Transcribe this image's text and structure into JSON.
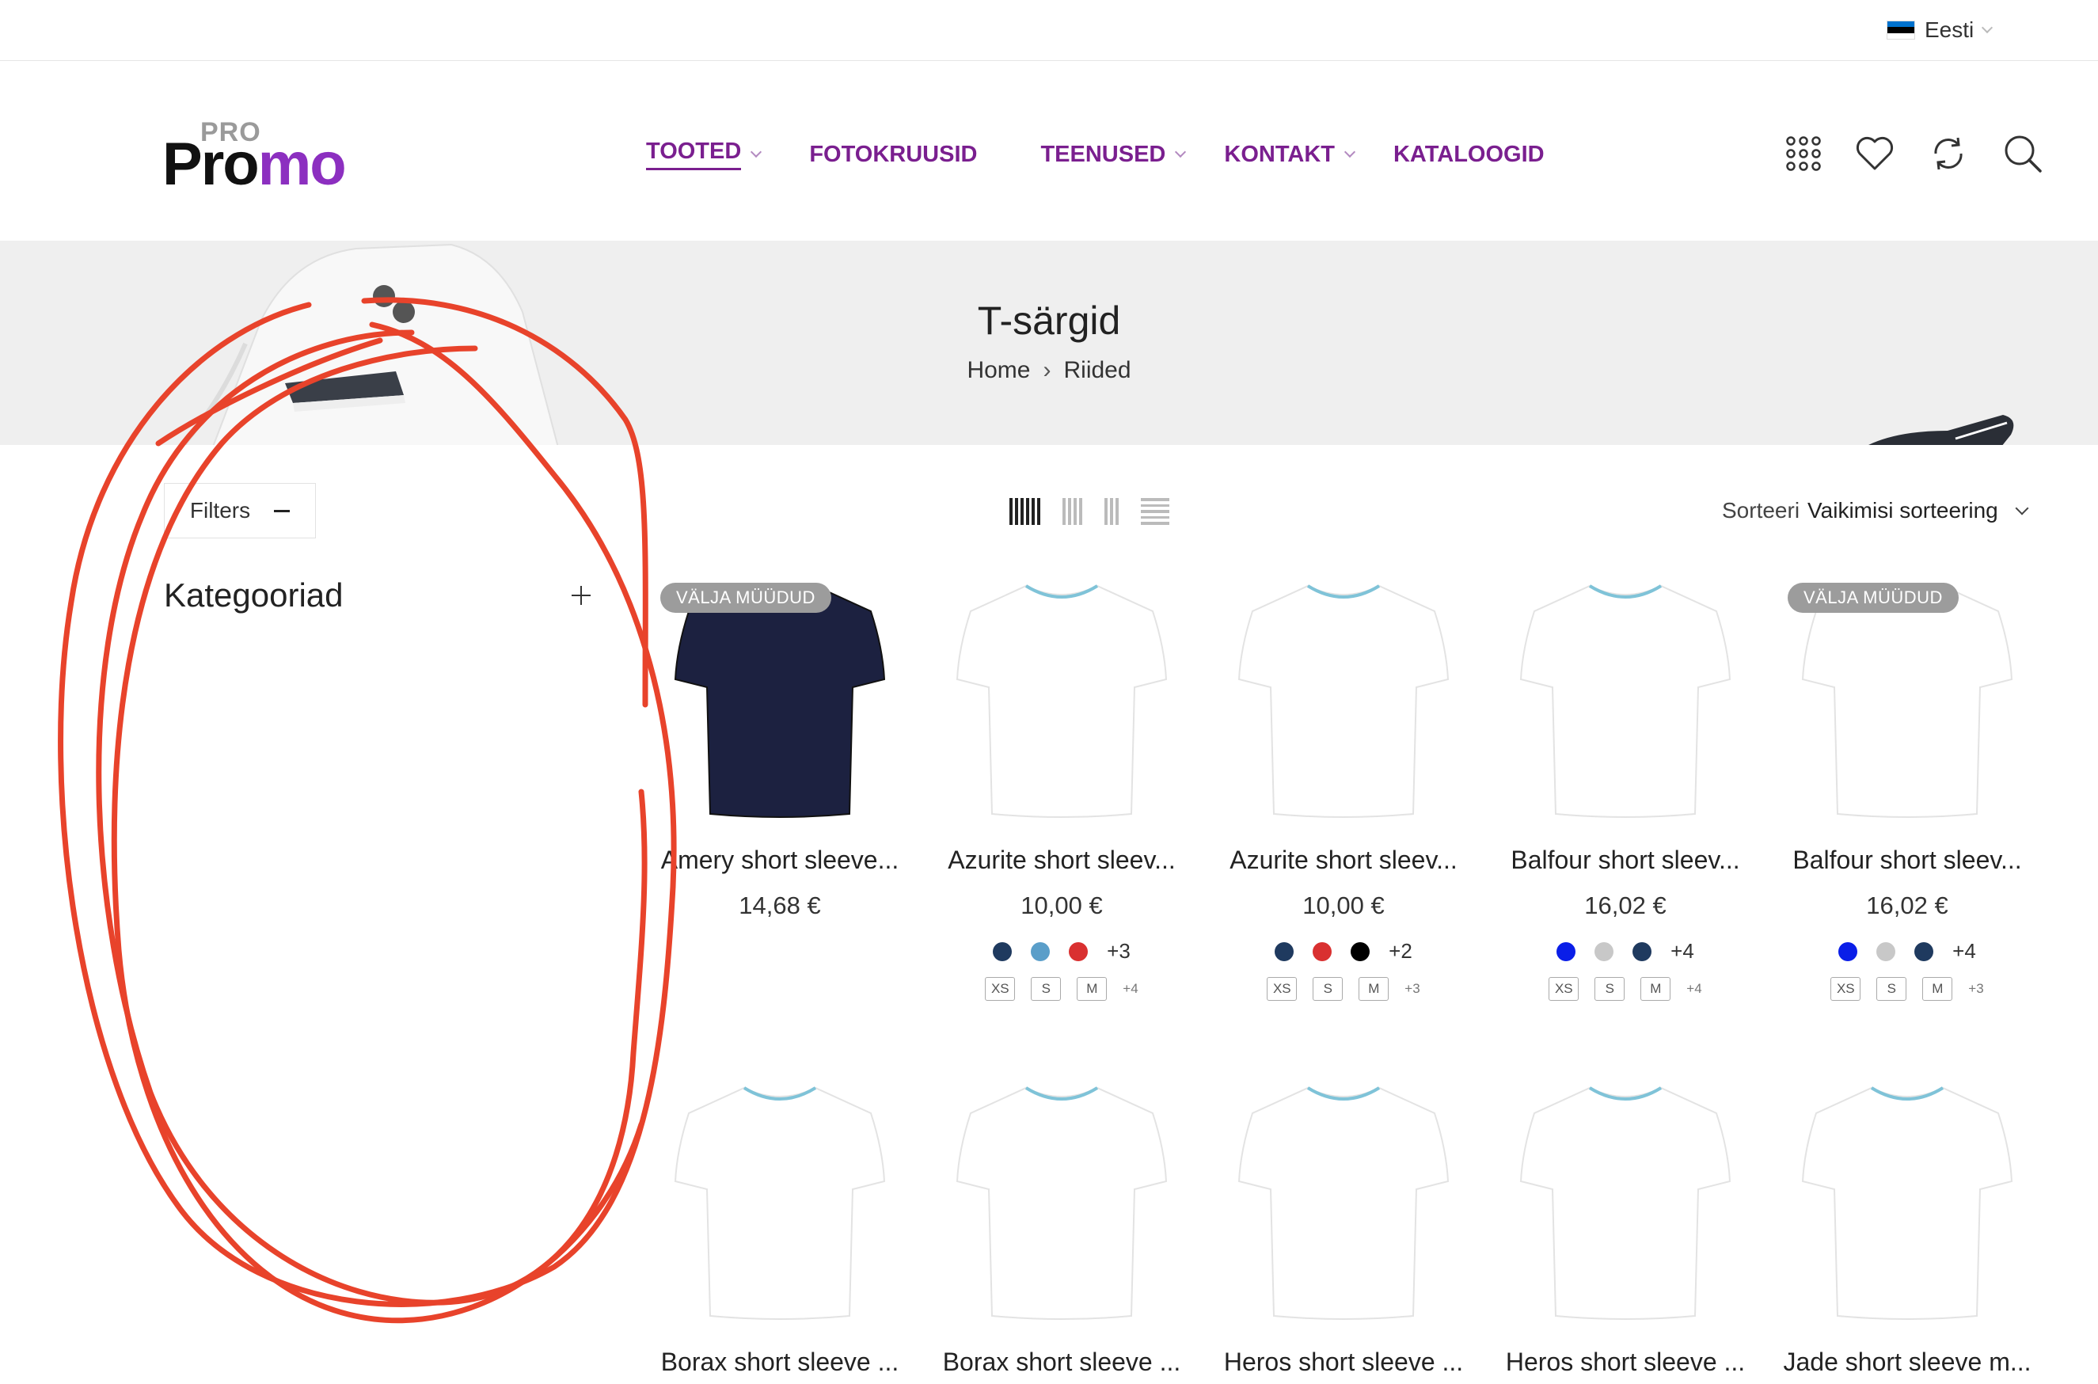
{
  "topbar": {
    "language": "Eesti"
  },
  "logo": {
    "small": "PRO",
    "part1": "Pro",
    "part2": "mo"
  },
  "nav": [
    {
      "label": "TOOTED",
      "dropdown": true,
      "active": true
    },
    {
      "label": "FOTOKRUUSID",
      "dropdown": false,
      "active": false
    },
    {
      "label": "TEENUSED",
      "dropdown": true,
      "active": false
    },
    {
      "label": "KONTAKT",
      "dropdown": true,
      "active": false
    },
    {
      "label": "KATALOOGID",
      "dropdown": false,
      "active": false
    }
  ],
  "banner": {
    "title": "T-särgid",
    "breadcrumb": [
      "Home",
      "Riided"
    ]
  },
  "sidebar": {
    "filters_label": "Filters",
    "category_title": "Kategooriad"
  },
  "sort": {
    "label": "Sorteeri",
    "value": "Vaikimisi sorteering"
  },
  "products": [
    {
      "name": "Amery short sleeve...",
      "price": "14,68 €",
      "badge": "VÄLJA MÜÜDUD",
      "shirt": "#1c2140",
      "colors": [],
      "colors_more": "",
      "sizes": [],
      "sizes_more": ""
    },
    {
      "name": "Azurite short sleev...",
      "price": "10,00 €",
      "badge": "",
      "shirt": "#ffffff",
      "colors": [
        "#1f3a5f",
        "#5a9ec9",
        "#d93030"
      ],
      "colors_more": "+3",
      "sizes": [
        "XS",
        "S",
        "M"
      ],
      "sizes_more": "+4"
    },
    {
      "name": "Azurite short sleev...",
      "price": "10,00 €",
      "badge": "",
      "shirt": "#ffffff",
      "colors": [
        "#1f3a5f",
        "#d93030",
        "#000000"
      ],
      "colors_more": "+2",
      "sizes": [
        "XS",
        "S",
        "M"
      ],
      "sizes_more": "+3"
    },
    {
      "name": "Balfour short sleev...",
      "price": "16,02 €",
      "badge": "",
      "shirt": "#ffffff",
      "colors": [
        "#0a1ee8",
        "#c8c8c8",
        "#1f3a5f"
      ],
      "colors_more": "+4",
      "sizes": [
        "XS",
        "S",
        "M"
      ],
      "sizes_more": "+4"
    },
    {
      "name": "Balfour short sleev...",
      "price": "16,02 €",
      "badge": "VÄLJA MÜÜDUD",
      "shirt": "#ffffff",
      "colors": [
        "#0a1ee8",
        "#c8c8c8",
        "#1f3a5f"
      ],
      "colors_more": "+4",
      "sizes": [
        "XS",
        "S",
        "M"
      ],
      "sizes_more": "+3"
    },
    {
      "name": "Borax short sleeve ...",
      "price": "",
      "badge": "",
      "shirt": "#ffffff",
      "colors": [],
      "colors_more": "",
      "sizes": [],
      "sizes_more": ""
    },
    {
      "name": "Borax short sleeve ...",
      "price": "",
      "badge": "",
      "shirt": "#ffffff",
      "colors": [],
      "colors_more": "",
      "sizes": [],
      "sizes_more": ""
    },
    {
      "name": "Heros short sleeve ...",
      "price": "",
      "badge": "",
      "shirt": "#ffffff",
      "colors": [],
      "colors_more": "",
      "sizes": [],
      "sizes_more": ""
    },
    {
      "name": "Heros short sleeve ...",
      "price": "",
      "badge": "",
      "shirt": "#ffffff",
      "colors": [],
      "colors_more": "",
      "sizes": [],
      "sizes_more": ""
    },
    {
      "name": "Jade short sleeve m...",
      "price": "",
      "badge": "",
      "shirt": "#ffffff",
      "colors": [],
      "colors_more": "",
      "sizes": [],
      "sizes_more": ""
    }
  ],
  "colors": {
    "brand_purple": "#7a1f8f",
    "logo_purple": "#8c2fc0",
    "annotation_red": "#e8432b",
    "badge_gray": "#9c9c9c"
  }
}
